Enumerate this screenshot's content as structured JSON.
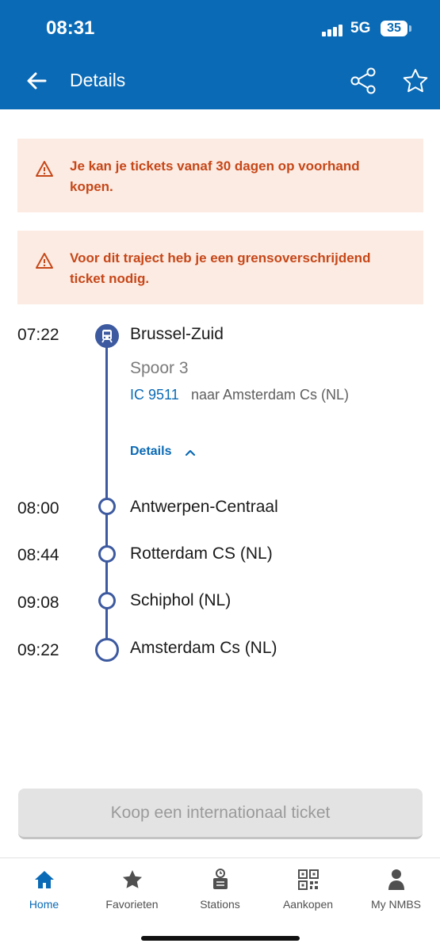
{
  "status_bar": {
    "time": "08:31",
    "network": "5G",
    "battery": "35"
  },
  "header": {
    "title": "Details"
  },
  "alerts": [
    {
      "text": "Je kan je tickets vanaf 30 dagen op voorhand kopen."
    },
    {
      "text": "Voor dit traject heb je een grensoverschrijdend ticket nodig."
    }
  ],
  "journey": {
    "departure": {
      "time": "07:22",
      "station": "Brussel-Zuid",
      "platform": "Spoor 3",
      "train_number": "IC 9511",
      "destination": "naar Amsterdam Cs (NL)"
    },
    "details_label": "Details",
    "stops": [
      {
        "time": "08:00",
        "station": "Antwerpen-Centraal"
      },
      {
        "time": "08:44",
        "station": "Rotterdam CS (NL)"
      },
      {
        "time": "09:08",
        "station": "Schiphol (NL)"
      },
      {
        "time": "09:22",
        "station": "Amsterdam Cs (NL)"
      }
    ]
  },
  "buy_button": {
    "label": "Koop een internationaal ticket"
  },
  "tabs": [
    {
      "label": "Home",
      "icon": "home-icon",
      "active": true
    },
    {
      "label": "Favorieten",
      "icon": "star-icon"
    },
    {
      "label": "Stations",
      "icon": "station-icon"
    },
    {
      "label": "Aankopen",
      "icon": "qr-code-icon"
    },
    {
      "label": "My NMBS",
      "icon": "user-icon"
    }
  ],
  "colors": {
    "brand": "#0a6ab5",
    "timeline": "#3d5aa0",
    "alert_bg": "#fcebe3",
    "alert_text": "#c64718"
  }
}
